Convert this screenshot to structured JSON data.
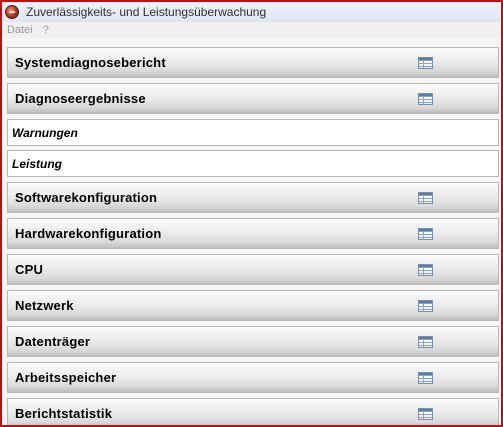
{
  "window": {
    "title": "Zuverlässigkeits- und Leistungsüberwachung"
  },
  "menu": {
    "items": [
      "Datei",
      "?"
    ]
  },
  "sections": [
    {
      "label": "Systemdiagnosebericht",
      "kind": "section",
      "icon": "report-icon"
    },
    {
      "label": "Diagnoseergebnisse",
      "kind": "section",
      "icon": "report-icon"
    },
    {
      "label": "Warnungen",
      "kind": "sub"
    },
    {
      "label": "Leistung",
      "kind": "sub"
    },
    {
      "label": "Softwarekonfiguration",
      "kind": "section",
      "icon": "report-icon"
    },
    {
      "label": "Hardwarekonfiguration",
      "kind": "section",
      "icon": "report-icon"
    },
    {
      "label": "CPU",
      "kind": "section",
      "icon": "report-icon"
    },
    {
      "label": "Netzwerk",
      "kind": "section",
      "icon": "report-icon"
    },
    {
      "label": "Datenträger",
      "kind": "section",
      "icon": "report-icon"
    },
    {
      "label": "Arbeitsspeicher",
      "kind": "section",
      "icon": "report-icon"
    },
    {
      "label": "Berichtstatistik",
      "kind": "section",
      "icon": "report-icon"
    }
  ],
  "colors": {
    "window_border": "#e00000",
    "menu_text": "#9a9a9a"
  }
}
